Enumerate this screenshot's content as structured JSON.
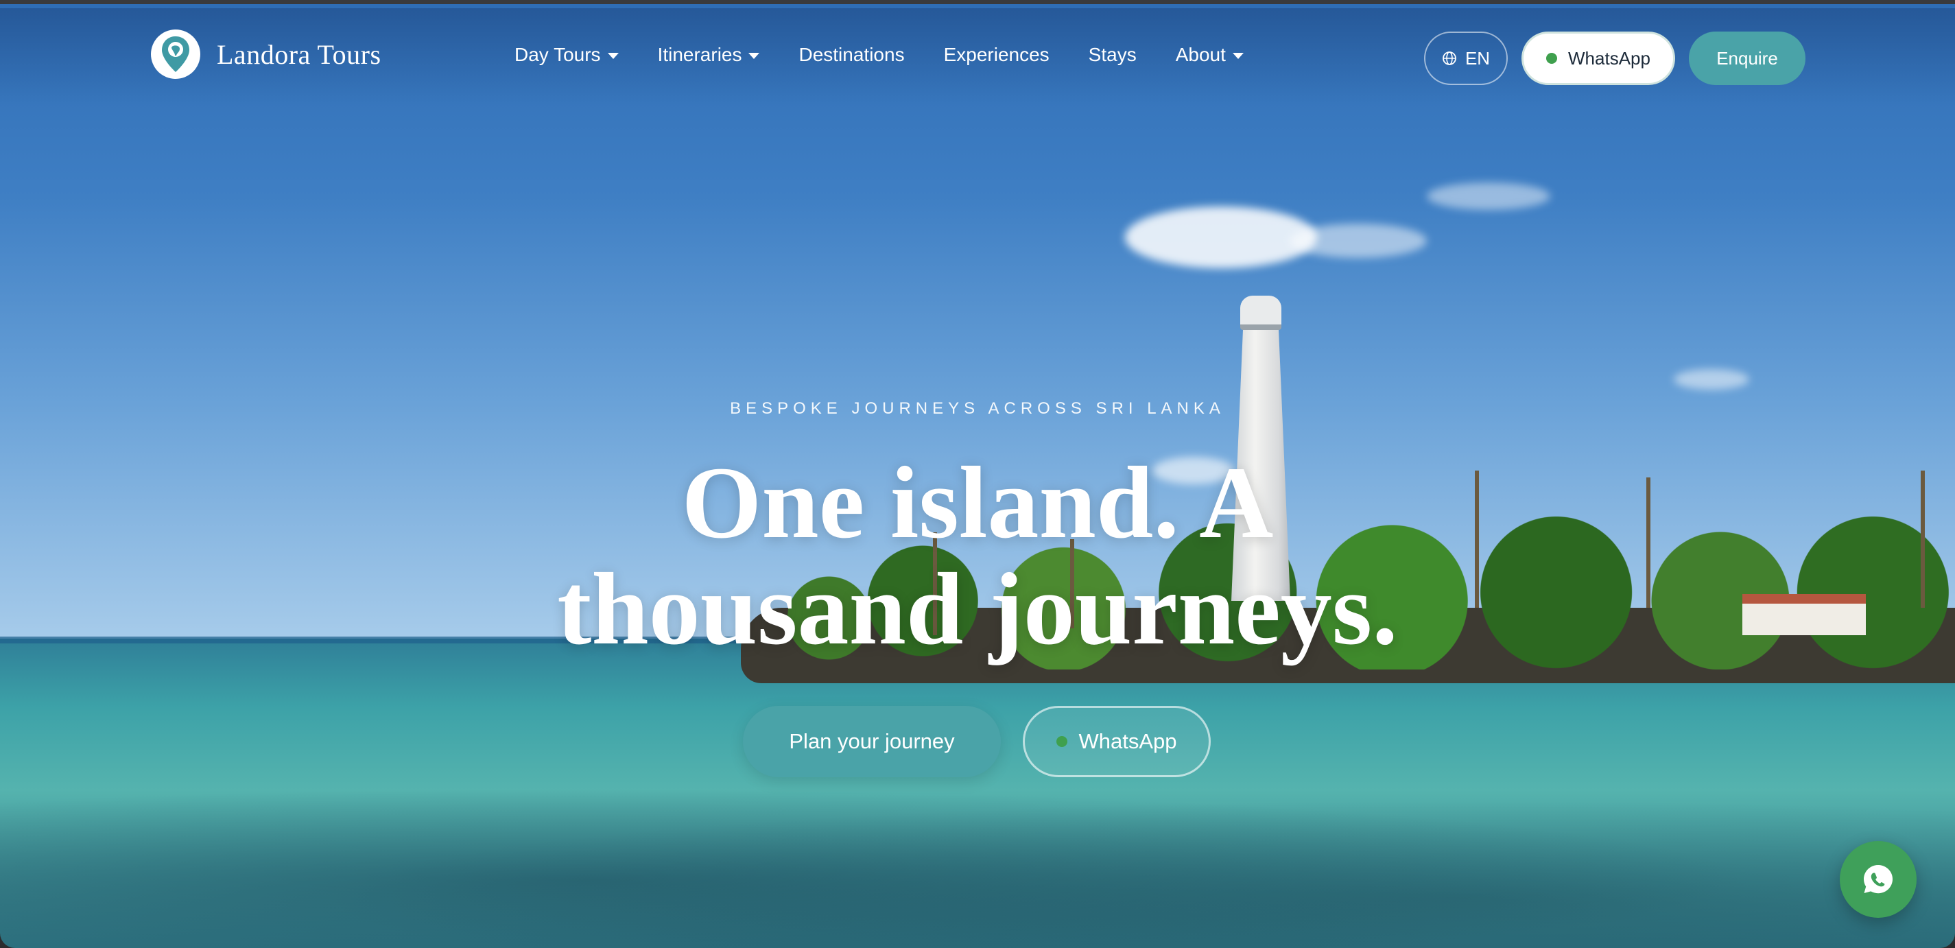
{
  "brand": {
    "name": "Landora Tours",
    "logo_icon": "map-pin-elephant-icon"
  },
  "nav": {
    "items": [
      {
        "label": "Day Tours",
        "has_dropdown": true
      },
      {
        "label": "Itineraries",
        "has_dropdown": true
      },
      {
        "label": "Destinations",
        "has_dropdown": false
      },
      {
        "label": "Experiences",
        "has_dropdown": false
      },
      {
        "label": "Stays",
        "has_dropdown": false
      },
      {
        "label": "About",
        "has_dropdown": true
      }
    ],
    "language": "EN",
    "whatsapp_label": "WhatsApp",
    "enquire_label": "Enquire"
  },
  "hero": {
    "eyebrow": "BESPOKE JOURNEYS ACROSS SRI LANKA",
    "headline": "One island. A thousand journeys.",
    "primary_cta": "Plan your journey",
    "secondary_cta": "WhatsApp"
  },
  "colors": {
    "accent": "#4aa3a8",
    "whatsapp_green": "#3fa04e"
  }
}
